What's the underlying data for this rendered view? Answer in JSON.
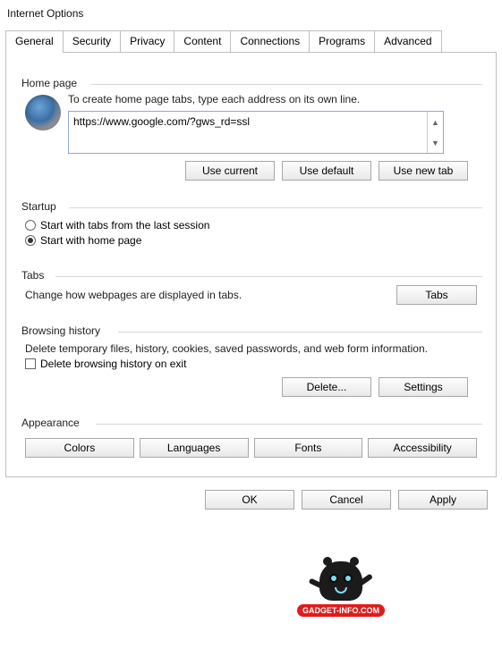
{
  "window": {
    "title": "Internet Options"
  },
  "tabs": [
    "General",
    "Security",
    "Privacy",
    "Content",
    "Connections",
    "Programs",
    "Advanced"
  ],
  "active_tab": 0,
  "home_page": {
    "label": "Home page",
    "hint": "To create home page tabs, type each address on its own line.",
    "url": "https://www.google.com/?gws_rd=ssl",
    "btn_current": "Use current",
    "btn_default": "Use default",
    "btn_newtab": "Use new tab"
  },
  "startup": {
    "label": "Startup",
    "opt_last": "Start with tabs from the last session",
    "opt_home": "Start with home page",
    "selected": "home"
  },
  "tabs_group": {
    "label": "Tabs",
    "desc": "Change how webpages are displayed in tabs.",
    "btn": "Tabs"
  },
  "history": {
    "label": "Browsing history",
    "desc": "Delete temporary files, history, cookies, saved passwords, and web form information.",
    "chk": "Delete browsing history on exit",
    "chk_checked": false,
    "btn_delete": "Delete...",
    "btn_settings": "Settings"
  },
  "appearance": {
    "label": "Appearance",
    "btn_colors": "Colors",
    "btn_lang": "Languages",
    "btn_fonts": "Fonts",
    "btn_access": "Accessibility"
  },
  "footer": {
    "ok": "OK",
    "cancel": "Cancel",
    "apply": "Apply"
  },
  "watermark": "GADGET-INFO.COM"
}
